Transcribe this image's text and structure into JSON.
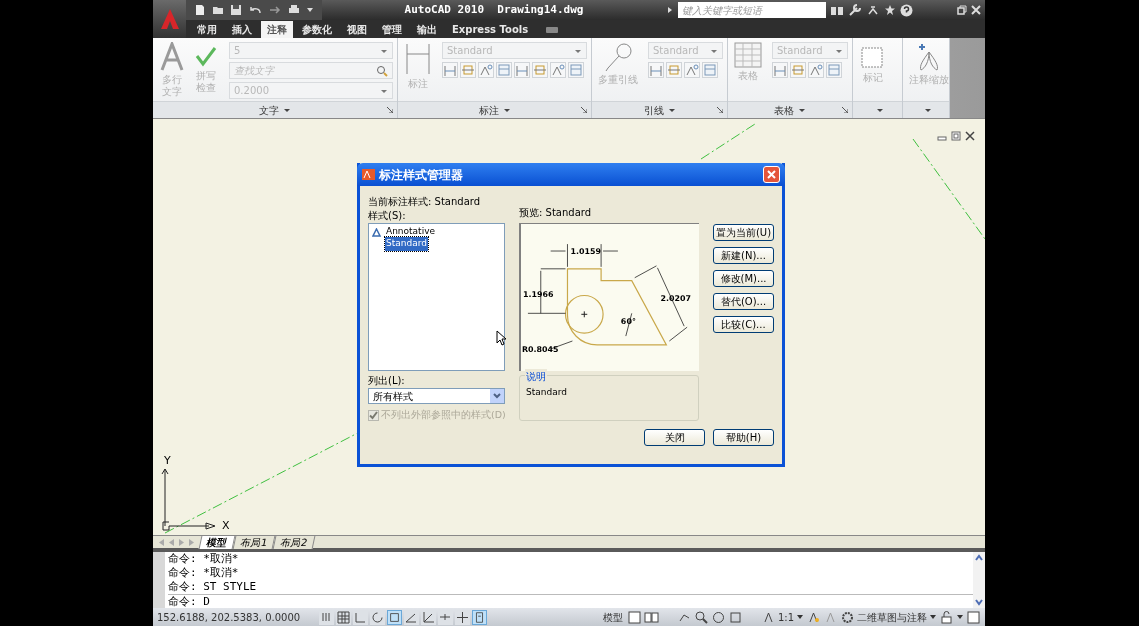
{
  "title_bar": {
    "title": "AutoCAD 2010  Drawing14.dwg",
    "search": {
      "placeholder": "键入关键字或短语"
    }
  },
  "ribbon_tabs": [
    {
      "label": "常用",
      "selected": false
    },
    {
      "label": "插入",
      "selected": false
    },
    {
      "label": "注释",
      "selected": true
    },
    {
      "label": "参数化",
      "selected": false
    },
    {
      "label": "视图",
      "selected": false
    },
    {
      "label": "管理",
      "selected": false
    },
    {
      "label": "输出",
      "selected": false
    },
    {
      "label": "Express Tools",
      "selected": false
    }
  ],
  "ribbon_panels": [
    {
      "kind": "text",
      "footer": "文字",
      "buttons": [
        "多行文字",
        "拼写检查"
      ],
      "fields": [
        {
          "value": "5"
        },
        {
          "placeholder": "查找文字"
        },
        {
          "value": "0.2000"
        }
      ]
    },
    {
      "kind": "dimension",
      "footer": "标注",
      "buttons": [
        "标注"
      ],
      "fields": [
        {
          "value": "Standard"
        }
      ]
    },
    {
      "kind": "leader",
      "footer": "引线",
      "buttons": [
        "多重引线"
      ],
      "fields": [
        {
          "value": "Standard"
        }
      ]
    },
    {
      "kind": "table",
      "footer": "表格",
      "buttons": [
        "表格"
      ],
      "fields": [
        {
          "value": "Standard"
        }
      ]
    },
    {
      "kind": "markup",
      "buttons": [
        "标记"
      ]
    },
    {
      "kind": "scale",
      "buttons": [
        "注释缩放"
      ]
    }
  ],
  "canvas": {
    "ucs": {
      "y": "Y",
      "x": "X"
    }
  },
  "dialog": {
    "title": "标注样式管理器",
    "current_style": "当前标注样式: Standard",
    "styles_label": "样式(S):",
    "styles": [
      {
        "label": "Annotative",
        "kind": "annotative",
        "selected": false
      },
      {
        "label": "Standard",
        "kind": "plain",
        "selected": true
      }
    ],
    "preview_label": "预览: Standard",
    "preview": {
      "labels": [
        "1.0159",
        "1.1966",
        "2.0207",
        "60°",
        "R0.8045"
      ]
    },
    "buttons": [
      "置为当前(U)",
      "新建(N)...",
      "修改(M)...",
      "替代(O)...",
      "比较(C)..."
    ],
    "list_label": "列出(L):",
    "list_value": "所有样式",
    "exclude_xref": {
      "label": "不列出外部参照中的样式(D)",
      "checked": true,
      "disabled": true
    },
    "description": {
      "title": "说明",
      "text": "Standard"
    },
    "footer_buttons": [
      "关闭",
      "帮助(H)"
    ]
  },
  "layout_tabs": [
    {
      "label": "模型",
      "selected": true
    },
    {
      "label": "布局1",
      "selected": false
    },
    {
      "label": "布局2",
      "selected": false
    }
  ],
  "command": {
    "history": [
      "命令: *取消*",
      "命令: *取消*",
      "命令: ST STYLE"
    ],
    "input": "命令: D"
  },
  "status_bar": {
    "coordinates": "152.6188, 202.5383, 0.0000",
    "toggles": [
      {
        "on": false
      },
      {
        "on": false
      },
      {
        "on": false
      },
      {
        "on": false
      },
      {
        "on": true
      },
      {
        "on": false
      },
      {
        "on": false
      },
      {
        "on": false
      },
      {
        "on": false
      },
      {
        "on": true
      }
    ],
    "model": "模型",
    "scale": "1:1",
    "workspace": "二维草图与注释"
  }
}
